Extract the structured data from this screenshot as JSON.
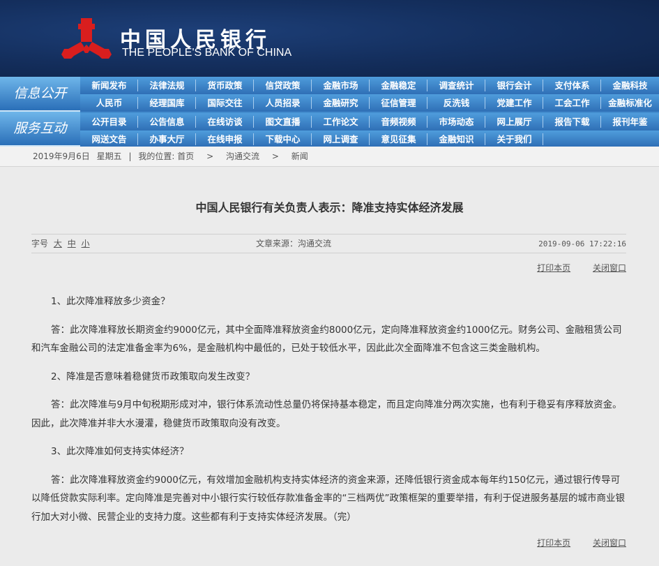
{
  "header": {
    "cn_name": "中国人民银行",
    "en_name": "THE PEOPLE'S BANK OF CHINA"
  },
  "nav": {
    "sections": [
      "信息公开",
      "服务互动"
    ],
    "rows": [
      [
        "新闻发布",
        "法律法规",
        "货币政策",
        "信贷政策",
        "金融市场",
        "金融稳定",
        "调查统计",
        "银行会计",
        "支付体系",
        "金融科技"
      ],
      [
        "人民币",
        "经理国库",
        "国际交往",
        "人员招录",
        "金融研究",
        "征信管理",
        "反洗钱",
        "党建工作",
        "工会工作",
        "金融标准化"
      ],
      [
        "公开目录",
        "公告信息",
        "在线访谈",
        "图文直播",
        "工作论文",
        "音频视频",
        "市场动态",
        "网上展厅",
        "报告下载",
        "报刊年鉴"
      ],
      [
        "网送文告",
        "办事大厅",
        "在线申报",
        "下载中心",
        "网上调查",
        "意见征集",
        "金融知识",
        "关于我们"
      ]
    ]
  },
  "breadcrumb": {
    "date": "2019年9月6日",
    "weekday": "星期五",
    "sep": "|",
    "label": "我的位置:",
    "items": [
      "首页",
      "沟通交流",
      "新闻"
    ],
    "arrow": ">"
  },
  "article": {
    "title": "中国人民银行有关负责人表示：降准支持实体经济发展",
    "font_label": "字号",
    "font_sizes": [
      "大",
      "中",
      "小"
    ],
    "source": "文章来源：沟通交流",
    "time": "2019-09-06 17:22:16",
    "print": "打印本页",
    "close": "关闭窗口",
    "paragraphs": [
      "1、此次降准释放多少资金？",
      "答：此次降准释放长期资金约9000亿元，其中全面降准释放资金约8000亿元，定向降准释放资金约1000亿元。财务公司、金融租赁公司和汽车金融公司的法定准备金率为6%，是金融机构中最低的，已处于较低水平，因此此次全面降准不包含这三类金融机构。",
      "2、降准是否意味着稳健货币政策取向发生改变？",
      "答：此次降准与9月中旬税期形成对冲，银行体系流动性总量仍将保持基本稳定，而且定向降准分两次实施，也有利于稳妥有序释放资金。因此，此次降准并非大水漫灌，稳健货币政策取向没有改变。",
      "3、此次降准如何支持实体经济？",
      "答：此次降准释放资金约9000亿元，有效增加金融机构支持实体经济的资金来源，还降低银行资金成本每年约150亿元，通过银行传导可以降低贷款实际利率。定向降准是完善对中小银行实行较低存款准备金率的“三档两优”政策框架的重要举措，有利于促进服务基层的城市商业银行加大对小微、民营企业的支持力度。这些都有利于支持实体经济发展。（完）"
    ]
  }
}
